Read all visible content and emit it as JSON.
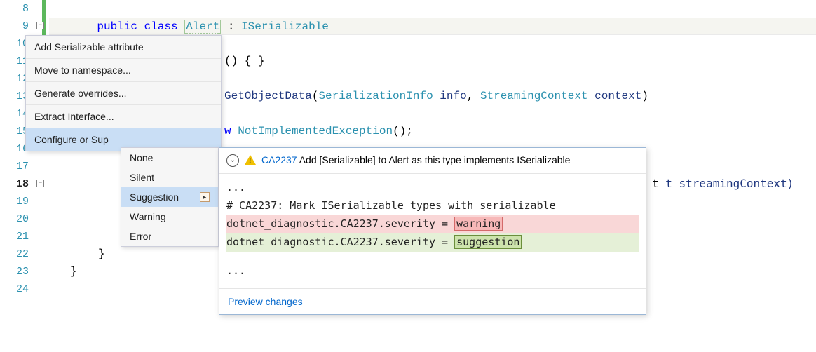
{
  "lines": {
    "8": "8",
    "9": "9",
    "10": "10",
    "11": "11",
    "12": "12",
    "13": "13",
    "14": "14",
    "15": "15",
    "16": "16",
    "17": "17",
    "18": "18",
    "19": "19",
    "20": "20",
    "21": "21",
    "22": "22",
    "23": "23",
    "24": "24"
  },
  "code": {
    "l9_public": "public",
    "l9_class": "class",
    "l9_alert": "Alert",
    "l9_colon": " : ",
    "l9_iser": "ISerializable",
    "l11_tail": "() { }",
    "l13_get": "GetObjectData",
    "l13_p1t": "SerializationInfo",
    "l13_p1n": " info",
    "l13_sep": ", ",
    "l13_p2t": "StreamingContext",
    "l13_p2n": " context",
    "l13_close": ")",
    "l15_w": "w ",
    "l15_ex": "NotImplementedException",
    "l15_tail": "();",
    "l22_brace": "}",
    "l23_brace": "}",
    "behind_right": "t streamingContext)"
  },
  "menu1": {
    "i0": "Add Serializable attribute",
    "i1": "Move to namespace...",
    "i2": "Generate overrides...",
    "i3": "Extract Interface...",
    "i4": "Configure or Sup"
  },
  "submenu": {
    "i0": "None",
    "i1": "Silent",
    "i2": "Suggestion",
    "i3": "Warning",
    "i4": "Error"
  },
  "preview": {
    "rule": "CA2237",
    "title_rest": " Add [Serializable] to Alert as this type implements ISerializable",
    "ell": "...",
    "comment": "# CA2237: Mark ISerializable types with serializable",
    "del_prefix": "dotnet_diagnostic.CA2237.severity = ",
    "del_val": "warning",
    "add_prefix": "dotnet_diagnostic.CA2237.severity = ",
    "add_val": "suggestion",
    "footer": "Preview changes"
  }
}
